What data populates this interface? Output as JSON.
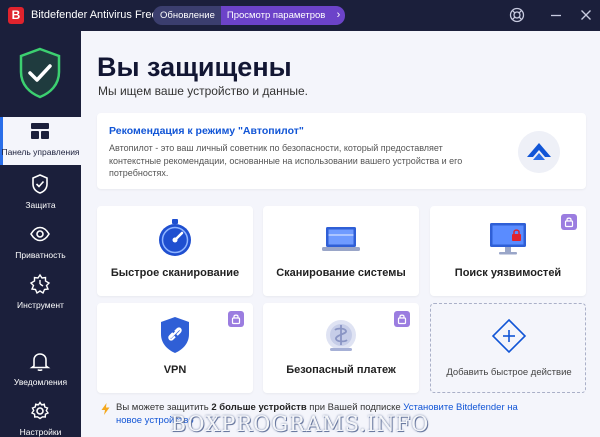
{
  "titlebar": {
    "app_title": "Bitdefender Antivirus Free",
    "logo_letter": "B",
    "update_label": "Обновление",
    "view_params_label": "Просмотр параметров"
  },
  "sidebar": {
    "items": [
      {
        "label": "Панель управления",
        "icon": "dashboard-icon",
        "active": true
      },
      {
        "label": "Защита",
        "icon": "shield-icon"
      },
      {
        "label": "Приватность",
        "icon": "eye-icon"
      },
      {
        "label": "Инструмент",
        "icon": "tools-icon"
      },
      {
        "label": "Уведомления",
        "icon": "bell-icon"
      },
      {
        "label": "Настройки",
        "icon": "gear-icon"
      }
    ]
  },
  "main": {
    "title": "Вы защищены",
    "subtitle": "Мы ищем ваше устройство и данные.",
    "recommendation": {
      "title": "Рекомендация к режиму \"Автопилот\"",
      "text": "Автопилот - это ваш личный советник по безопасности, который предоставляет контекстные рекомендации, основанные на использовании вашего устройства и его потребностях."
    },
    "tiles": [
      {
        "label": "Быстрое сканирование",
        "icon": "quick-scan-icon",
        "locked": false
      },
      {
        "label": "Сканирование системы",
        "icon": "laptop-scan-icon",
        "locked": false
      },
      {
        "label": "Поиск уязвимостей",
        "icon": "vulnerability-monitor-icon",
        "locked": true
      },
      {
        "label": "VPN",
        "icon": "vpn-shield-icon",
        "locked": true
      },
      {
        "label": "Безопасный платеж",
        "icon": "safepay-icon",
        "locked": true
      },
      {
        "label": "Добавить быстрое действие",
        "icon": "plus-diamond-icon",
        "locked": false
      }
    ],
    "footer": {
      "part1": "Вы можете защитить ",
      "bold": "2 больше устройств",
      "part2": " при Вашей подписке ",
      "link": "Установите Bitdefender на новое устройство"
    }
  },
  "watermark": "BOXPROGRAMS.INFO",
  "colors": {
    "sidebar": "#1b1f3b",
    "accent_blue": "#1155d6",
    "accent_purple": "#6c43c9",
    "brand_red": "#e0232d",
    "shield_green": "#3cd070"
  }
}
